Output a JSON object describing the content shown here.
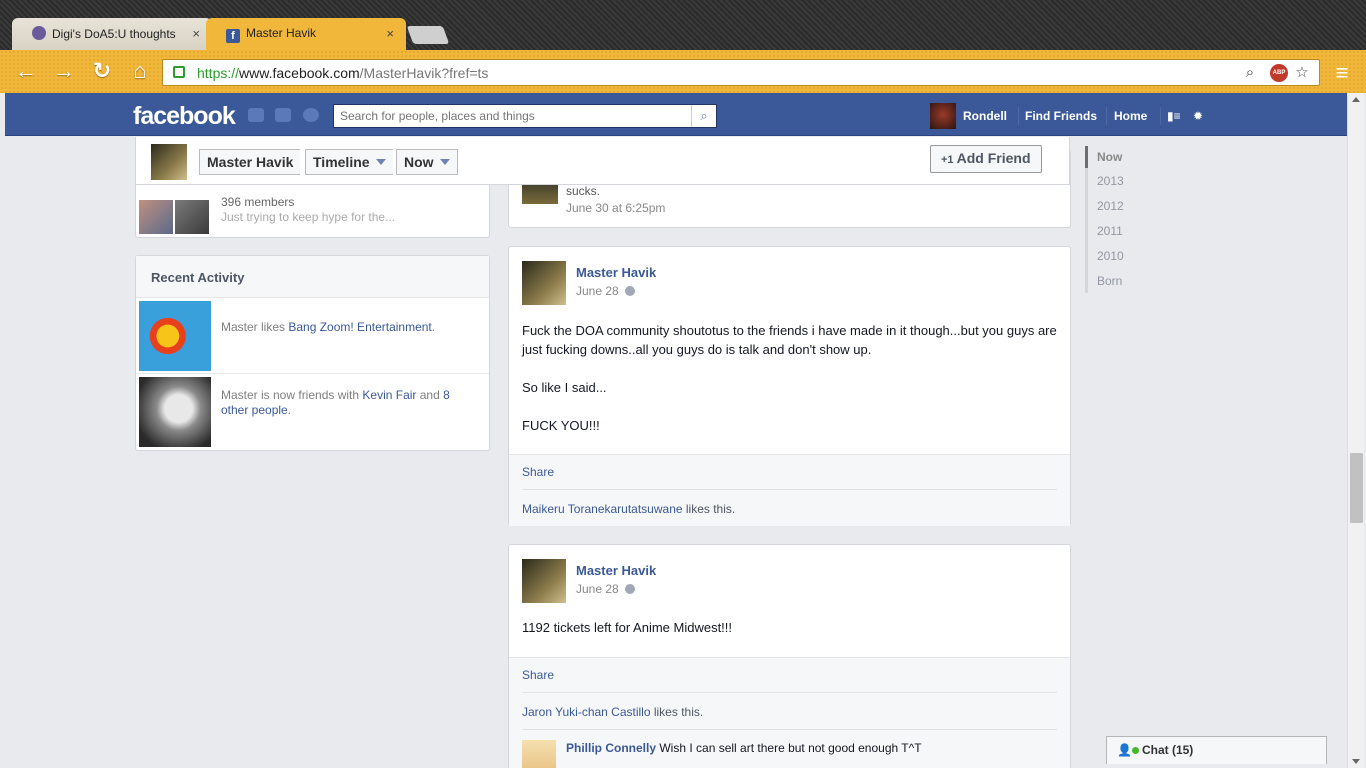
{
  "browser": {
    "tabs": [
      {
        "title": "Digi's DoA5:U thoughts",
        "close": "×"
      },
      {
        "title": "Master Havik",
        "close": "×"
      }
    ],
    "url_scheme": "https://",
    "url_host": "www.facebook.com",
    "url_path": "/MasterHavik?fref=ts",
    "abp_label": "ABP"
  },
  "fb_header": {
    "logo": "facebook",
    "search_placeholder": "Search for people, places and things",
    "user_name": "Rondell",
    "find_friends": "Find Friends",
    "home": "Home"
  },
  "profile_header": {
    "name": "Master Havik",
    "timeline": "Timeline",
    "now": "Now",
    "add_friend": "Add Friend"
  },
  "group": {
    "members": "396 members",
    "desc": "Just trying to keep hype for the..."
  },
  "recent_activity": {
    "title": "Recent Activity",
    "items": [
      {
        "prefix": "Master likes ",
        "link": "Bang Zoom! Entertainment",
        "suffix": "."
      },
      {
        "prefix": "Master is now friends with ",
        "link": "Kevin Fair",
        "mid": " and ",
        "link2": "8 other people",
        "suffix": "."
      }
    ]
  },
  "prev_post": {
    "text": "sucks.",
    "date": "June 30 at 6:25pm"
  },
  "posts": [
    {
      "author": "Master Havik",
      "date": "June 28",
      "paragraphs": [
        "Fuck the DOA community shoutotus to the friends i have made in it though...but you guys are just fucking downs..all you guys do is talk and don't show up.",
        "So like I said...",
        "FUCK YOU!!!"
      ],
      "share": "Share",
      "liker": "Maikeru Toranekarutatsuwane",
      "likes_suffix": " likes this."
    },
    {
      "author": "Master Havik",
      "date": "June 28",
      "paragraphs": [
        "1192 tickets left for Anime Midwest!!!"
      ],
      "share": "Share",
      "liker": "Jaron Yuki-chan Castillo",
      "likes_suffix": " likes this.",
      "comment_author": "Phillip Connelly",
      "comment_text": "Wish I can sell art there but not good enough T^T"
    }
  ],
  "timeline_nav": [
    "Now",
    "2013",
    "2012",
    "2011",
    "2010",
    "Born"
  ],
  "chat": {
    "label": "Chat (15)"
  },
  "colors": {
    "fb_blue": "#3b5998",
    "chrome_gold": "#f0b73a"
  }
}
